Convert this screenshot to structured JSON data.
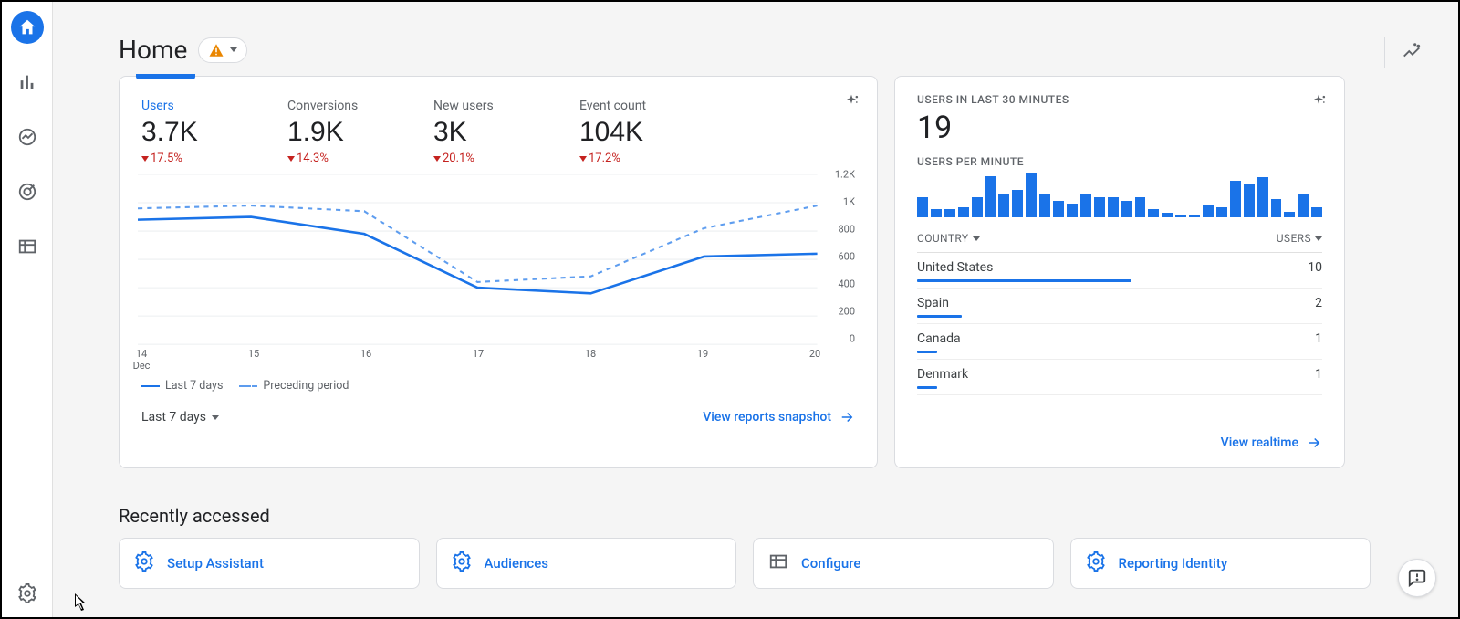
{
  "page": {
    "title": "Home"
  },
  "rail": [
    "home",
    "reports",
    "explore",
    "advertising",
    "configure",
    "admin"
  ],
  "overview": {
    "metrics": [
      {
        "label": "Users",
        "value": "3.7K",
        "delta": "17.5%",
        "active": true
      },
      {
        "label": "Conversions",
        "value": "1.9K",
        "delta": "14.3%",
        "active": false
      },
      {
        "label": "New users",
        "value": "3K",
        "delta": "20.1%",
        "active": false
      },
      {
        "label": "Event count",
        "value": "104K",
        "delta": "17.2%",
        "active": false
      }
    ],
    "range_label": "Last 7 days",
    "link_label": "View reports snapshot",
    "legend": {
      "current": "Last 7 days",
      "previous": "Preceding period"
    },
    "chart_data": {
      "type": "line",
      "x": [
        "14",
        "15",
        "16",
        "17",
        "18",
        "19",
        "20"
      ],
      "x_month": "Dec",
      "series": [
        {
          "name": "Last 7 days",
          "values": [
            880,
            900,
            780,
            400,
            360,
            620,
            640
          ]
        },
        {
          "name": "Preceding period",
          "values": [
            960,
            980,
            940,
            440,
            480,
            820,
            980
          ]
        }
      ],
      "y_ticks": [
        "1.2K",
        "1K",
        "800",
        "600",
        "400",
        "200",
        "0"
      ],
      "ylim": [
        0,
        1200
      ]
    }
  },
  "realtime": {
    "heading": "USERS IN LAST 30 MINUTES",
    "big": "19",
    "per_min_label": "USERS PER MINUTE",
    "spark": [
      22,
      9,
      9,
      11,
      22,
      45,
      25,
      30,
      48,
      25,
      18,
      15,
      25,
      22,
      22,
      18,
      22,
      9,
      5,
      2,
      0,
      14,
      11,
      40,
      36,
      44,
      20,
      6,
      25,
      11
    ],
    "table_head": {
      "left": "COUNTRY",
      "right": "USERS"
    },
    "rows": [
      {
        "country": "United States",
        "users": "10",
        "pct": 53
      },
      {
        "country": "Spain",
        "users": "2",
        "pct": 11
      },
      {
        "country": "Canada",
        "users": "1",
        "pct": 5
      },
      {
        "country": "Denmark",
        "users": "1",
        "pct": 5
      }
    ],
    "link_label": "View realtime"
  },
  "recent": {
    "title": "Recently accessed",
    "cards": [
      {
        "icon": "gear",
        "label": "Setup Assistant"
      },
      {
        "icon": "gear",
        "label": "Audiences"
      },
      {
        "icon": "table",
        "label": "Configure"
      },
      {
        "icon": "gear",
        "label": "Reporting Identity"
      }
    ]
  }
}
